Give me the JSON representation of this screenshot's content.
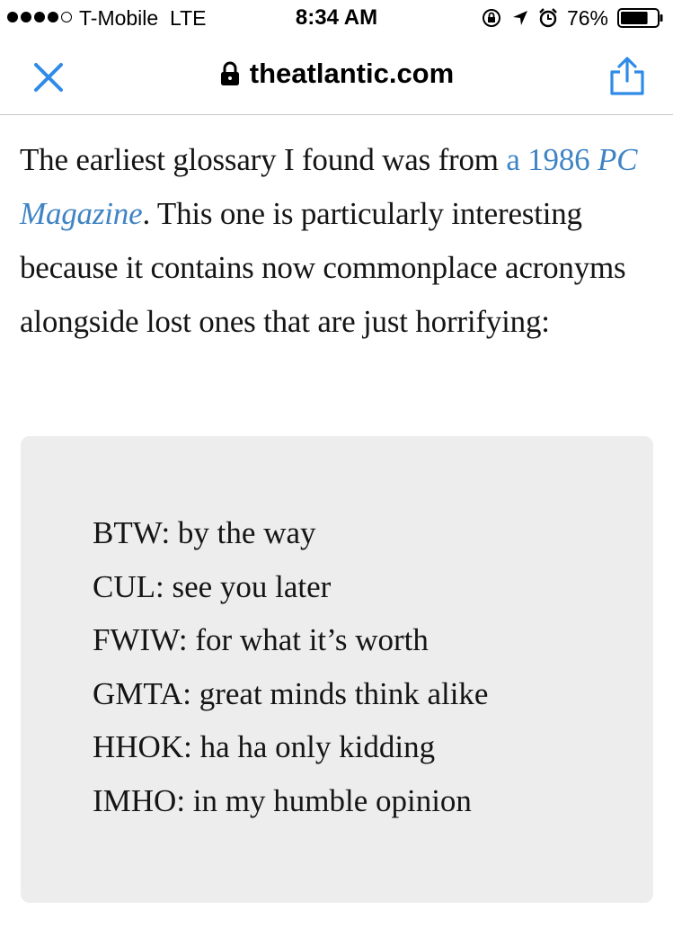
{
  "status_bar": {
    "carrier": "T-Mobile",
    "network": "LTE",
    "time": "8:34 AM",
    "battery": "76%",
    "battery_level": 0.76,
    "signal_bars": 4,
    "icons": [
      "orientation-lock-icon",
      "location-arrow-icon",
      "alarm-icon",
      "battery-icon"
    ]
  },
  "nav": {
    "url": "theatlantic.com",
    "icons": [
      "close-icon",
      "lock-icon",
      "share-icon"
    ],
    "accent_color": "#2f8be8"
  },
  "article": {
    "p1_before": "The earliest glossary I found was from ",
    "link_prefix": "a 1986 ",
    "link_italic": "PC Magazine",
    "p1_after": ". This one is particularly interesting because it contains now commonplace acronyms alongside lost ones that are just horrifying:",
    "link_color": "#3f84c4"
  },
  "glossary": {
    "items": [
      "BTW: by the way",
      "CUL: see you later",
      "FWIW: for what it’s worth",
      "GMTA: great minds think alike",
      "HHOK: ha ha only kidding",
      "IMHO: in my humble opinion"
    ]
  }
}
